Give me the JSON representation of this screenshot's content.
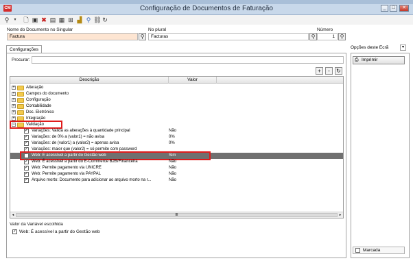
{
  "window": {
    "app_badge": "CM",
    "title": "Configuração de Documentos de Faturação",
    "controls": [
      "_",
      "□",
      "✕"
    ]
  },
  "fields": {
    "singular_label": "Nome do Documento no Singular",
    "singular_value": "Factura",
    "plural_label": "No plural",
    "plural_value": "Facturas",
    "number_label": "Número",
    "number_value": "1"
  },
  "tabs": {
    "config": "Configurações"
  },
  "search": {
    "label": "Procurar:",
    "value": ""
  },
  "grid": {
    "headers": {
      "description": "Descrição",
      "value": "Valor"
    },
    "folders": [
      {
        "label": "Alteração"
      },
      {
        "label": "Campos do documento"
      },
      {
        "label": "Configuração"
      },
      {
        "label": "Contabilidade"
      },
      {
        "label": "Doc. Eletrónico"
      },
      {
        "label": "Integração"
      },
      {
        "label": "Validação"
      }
    ],
    "items": [
      {
        "label": "Variações: Valida as alterações à quantidade principal",
        "value": "Não"
      },
      {
        "label": "Variações:  de   0%   a (valor1) = não avisa",
        "value": "0%"
      },
      {
        "label": "Variações: de (valor1) a (valor2) = apenas avisa",
        "value": "0%"
      },
      {
        "label": "Variações: maior que (valor2) = só permite com password",
        "value": ""
      },
      {
        "label": "Web: É acessível a partir do Gestão web",
        "value": "Sim"
      },
      {
        "label": "Web: É acessível a partir do E-Commerce B2B/Financeira",
        "value": "Não"
      },
      {
        "label": "Web: Permite pagamento via UNICRE",
        "value": "Não"
      },
      {
        "label": "Web: Permite pagamento via PAYPAL",
        "value": "Não"
      },
      {
        "label": "Arquivo morto: Documento para adicionar ao arquivo morto na r...",
        "value": "Não"
      }
    ],
    "scroll_glyph": "III"
  },
  "bottom": {
    "label": "Valor da Variável escolhida",
    "checkbox_label": "Web: É acessível a partir do Gestão web"
  },
  "right": {
    "options_label": "Opções deste Ecrã",
    "print_label": "Imprimir",
    "marked_label": "Marcada"
  },
  "colors": {
    "selected_row": "#707070",
    "highlight": "#e01b1b",
    "orange_field": "#fde5d2"
  }
}
